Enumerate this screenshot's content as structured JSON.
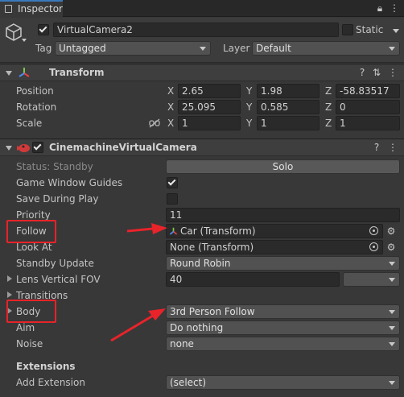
{
  "tab": {
    "title": "Inspector"
  },
  "gameobject": {
    "name": "VirtualCamera2",
    "static_label": "Static",
    "tag_label": "Tag",
    "tag_value": "Untagged",
    "layer_label": "Layer",
    "layer_value": "Default"
  },
  "transform": {
    "title": "Transform",
    "position_label": "Position",
    "rotation_label": "Rotation",
    "scale_label": "Scale",
    "x": "X",
    "y": "Y",
    "z": "Z",
    "position": {
      "x": "2.65",
      "y": "1.98",
      "z": "-58.83517"
    },
    "rotation": {
      "x": "25.095",
      "y": "0.585",
      "z": "0"
    },
    "scale": {
      "x": "1",
      "y": "1",
      "z": "1"
    }
  },
  "vcam": {
    "title": "CinemachineVirtualCamera",
    "status_label": "Status: Standby",
    "solo_label": "Solo",
    "game_window_guides_label": "Game Window Guides",
    "save_during_play_label": "Save During Play",
    "priority_label": "Priority",
    "priority_value": "11",
    "follow_label": "Follow",
    "follow_value": "Car (Transform)",
    "look_at_label": "Look At",
    "look_at_value": "None (Transform)",
    "standby_update_label": "Standby Update",
    "standby_update_value": "Round Robin",
    "lens_fov_label": "Lens Vertical FOV",
    "lens_fov_value": "40",
    "transitions_label": "Transitions",
    "body_label": "Body",
    "body_value": "3rd Person Follow",
    "aim_label": "Aim",
    "aim_value": "Do nothing",
    "noise_label": "Noise",
    "noise_value": "none",
    "extensions_label": "Extensions",
    "add_extension_label": "Add Extension",
    "add_extension_value": "(select)"
  },
  "annotation_color": "#e8232a"
}
